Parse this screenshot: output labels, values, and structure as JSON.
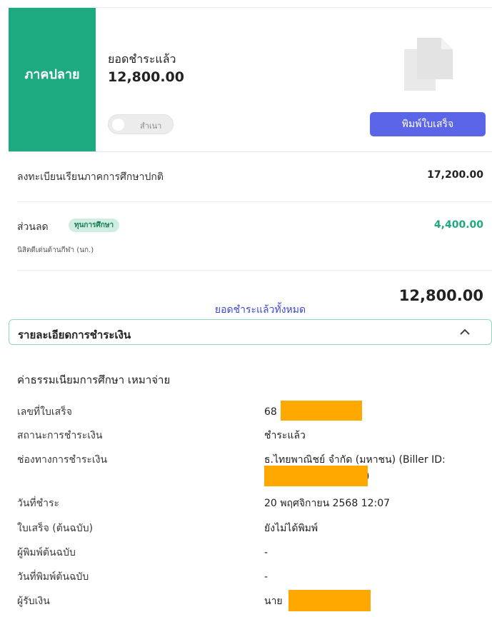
{
  "header": {
    "term": "ภาคปลาย",
    "paid_label": "ยอดชำระแล้ว",
    "paid_amount": "12,800.00",
    "toggle_label": "สำเนา",
    "print_button": "พิมพ์ใบเสร็จ"
  },
  "charges": [
    {
      "label": "ลงทะเบียนเรียนภาคการศึกษาปกติ",
      "value": "17,200.00"
    },
    {
      "label": "ส่วนลด",
      "badge": "ทุนการศึกษา",
      "note": "นิสิตดีเด่นด้านกีฬา (นก.)",
      "value": "4,400.00"
    }
  ],
  "total": {
    "label": "ยอดชำระแล้วทั้งหมด",
    "value": "12,800.00"
  },
  "details": {
    "section_title": "รายละเอียดการชำระเงิน",
    "fee_title": "ค่าธรรมเนียมการศึกษา เหมาจ่าย",
    "rows": [
      {
        "label": "เลขที่ใบเสร็จ",
        "value": "68"
      },
      {
        "label": "สถานะการชำระเงิน",
        "value": "ชำระแล้ว"
      },
      {
        "label": "ช่องทางการชำระเงิน",
        "value": "ธ.ไทยพาณิชย์ จำกัด (มหาชน) (Biller ID:",
        "value2": ")"
      },
      {
        "label": "วันที่ชำระ",
        "value": "20 พฤศจิกายน 2568 12:07"
      },
      {
        "label": "ใบเสร็จ (ต้นฉบับ)",
        "value": "ยังไม่ได้พิมพ์"
      },
      {
        "label": "ผู้พิมพ์ต้นฉบับ",
        "value": "-"
      },
      {
        "label": "วันที่พิมพ์ต้นฉบับ",
        "value": "-"
      },
      {
        "label": "ผู้รับเงิน",
        "value": "นาย"
      }
    ]
  },
  "colors": {
    "term_green": "#1daa80",
    "print_button": "#5b65e8",
    "discount_green": "#1daa80",
    "total_label_blue": "#3e47cc",
    "redaction": "#ffa800"
  },
  "icons": [
    "document-copy-icon",
    "chevron-up-icon"
  ]
}
